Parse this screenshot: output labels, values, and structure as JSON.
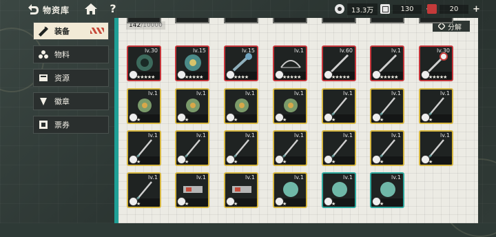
{
  "header": {
    "title": "物资库"
  },
  "resources": [
    {
      "name": "coin",
      "value": "13.3万"
    },
    {
      "name": "ticket",
      "value": "130"
    },
    {
      "name": "stamina",
      "value": "20"
    }
  ],
  "sidebar": {
    "items": [
      {
        "label": "装备",
        "active": true
      },
      {
        "label": "物料",
        "active": false
      },
      {
        "label": "资源",
        "active": false
      },
      {
        "label": "徽章",
        "active": false
      },
      {
        "label": "票券",
        "active": false
      }
    ]
  },
  "inventory": {
    "count": "142",
    "max": "/10000",
    "decompose_label": "分解"
  },
  "items": [
    {
      "level": "lv.30",
      "frame": "red",
      "stars": "★★★★★"
    },
    {
      "level": "lv.15",
      "frame": "red",
      "stars": "★★★★★"
    },
    {
      "level": "lv.15",
      "frame": "red",
      "stars": "★★★★"
    },
    {
      "level": "lv.1",
      "frame": "red",
      "stars": "★★★★★"
    },
    {
      "level": "lv.60",
      "frame": "red",
      "stars": "★★★★★"
    },
    {
      "level": "lv.1",
      "frame": "red",
      "stars": "★★★★★"
    },
    {
      "level": "lv.30",
      "frame": "red",
      "stars": "★★★★★"
    },
    {
      "level": "lv.1",
      "frame": "yellow",
      "stars": "★"
    },
    {
      "level": "lv.1",
      "frame": "yellow",
      "stars": "★"
    },
    {
      "level": "lv.1",
      "frame": "yellow",
      "stars": "★"
    },
    {
      "level": "lv.1",
      "frame": "yellow",
      "stars": "★"
    },
    {
      "level": "lv.1",
      "frame": "yellow",
      "stars": "★"
    },
    {
      "level": "lv.1",
      "frame": "yellow",
      "stars": "★"
    },
    {
      "level": "lv.1",
      "frame": "yellow",
      "stars": "★"
    },
    {
      "level": "lv.1",
      "frame": "yellow",
      "stars": "★"
    },
    {
      "level": "lv.1",
      "frame": "yellow",
      "stars": "★"
    },
    {
      "level": "lv.1",
      "frame": "yellow",
      "stars": "★"
    },
    {
      "level": "lv.1",
      "frame": "yellow",
      "stars": "★"
    },
    {
      "level": "lv.1",
      "frame": "yellow",
      "stars": "★"
    },
    {
      "level": "lv.1",
      "frame": "yellow",
      "stars": "★"
    },
    {
      "level": "lv.1",
      "frame": "yellow",
      "stars": "★"
    },
    {
      "level": "lv.1",
      "frame": "yellow",
      "stars": "★"
    },
    {
      "level": "lv.1",
      "frame": "yellow",
      "stars": "★"
    },
    {
      "level": "lv.1",
      "frame": "yellow",
      "stars": "★"
    },
    {
      "level": "lv.1",
      "frame": "yellow",
      "stars": "★"
    },
    {
      "level": "lv.1",
      "frame": "teal",
      "stars": "★"
    },
    {
      "level": "lv.1",
      "frame": "teal",
      "stars": "★"
    }
  ]
}
